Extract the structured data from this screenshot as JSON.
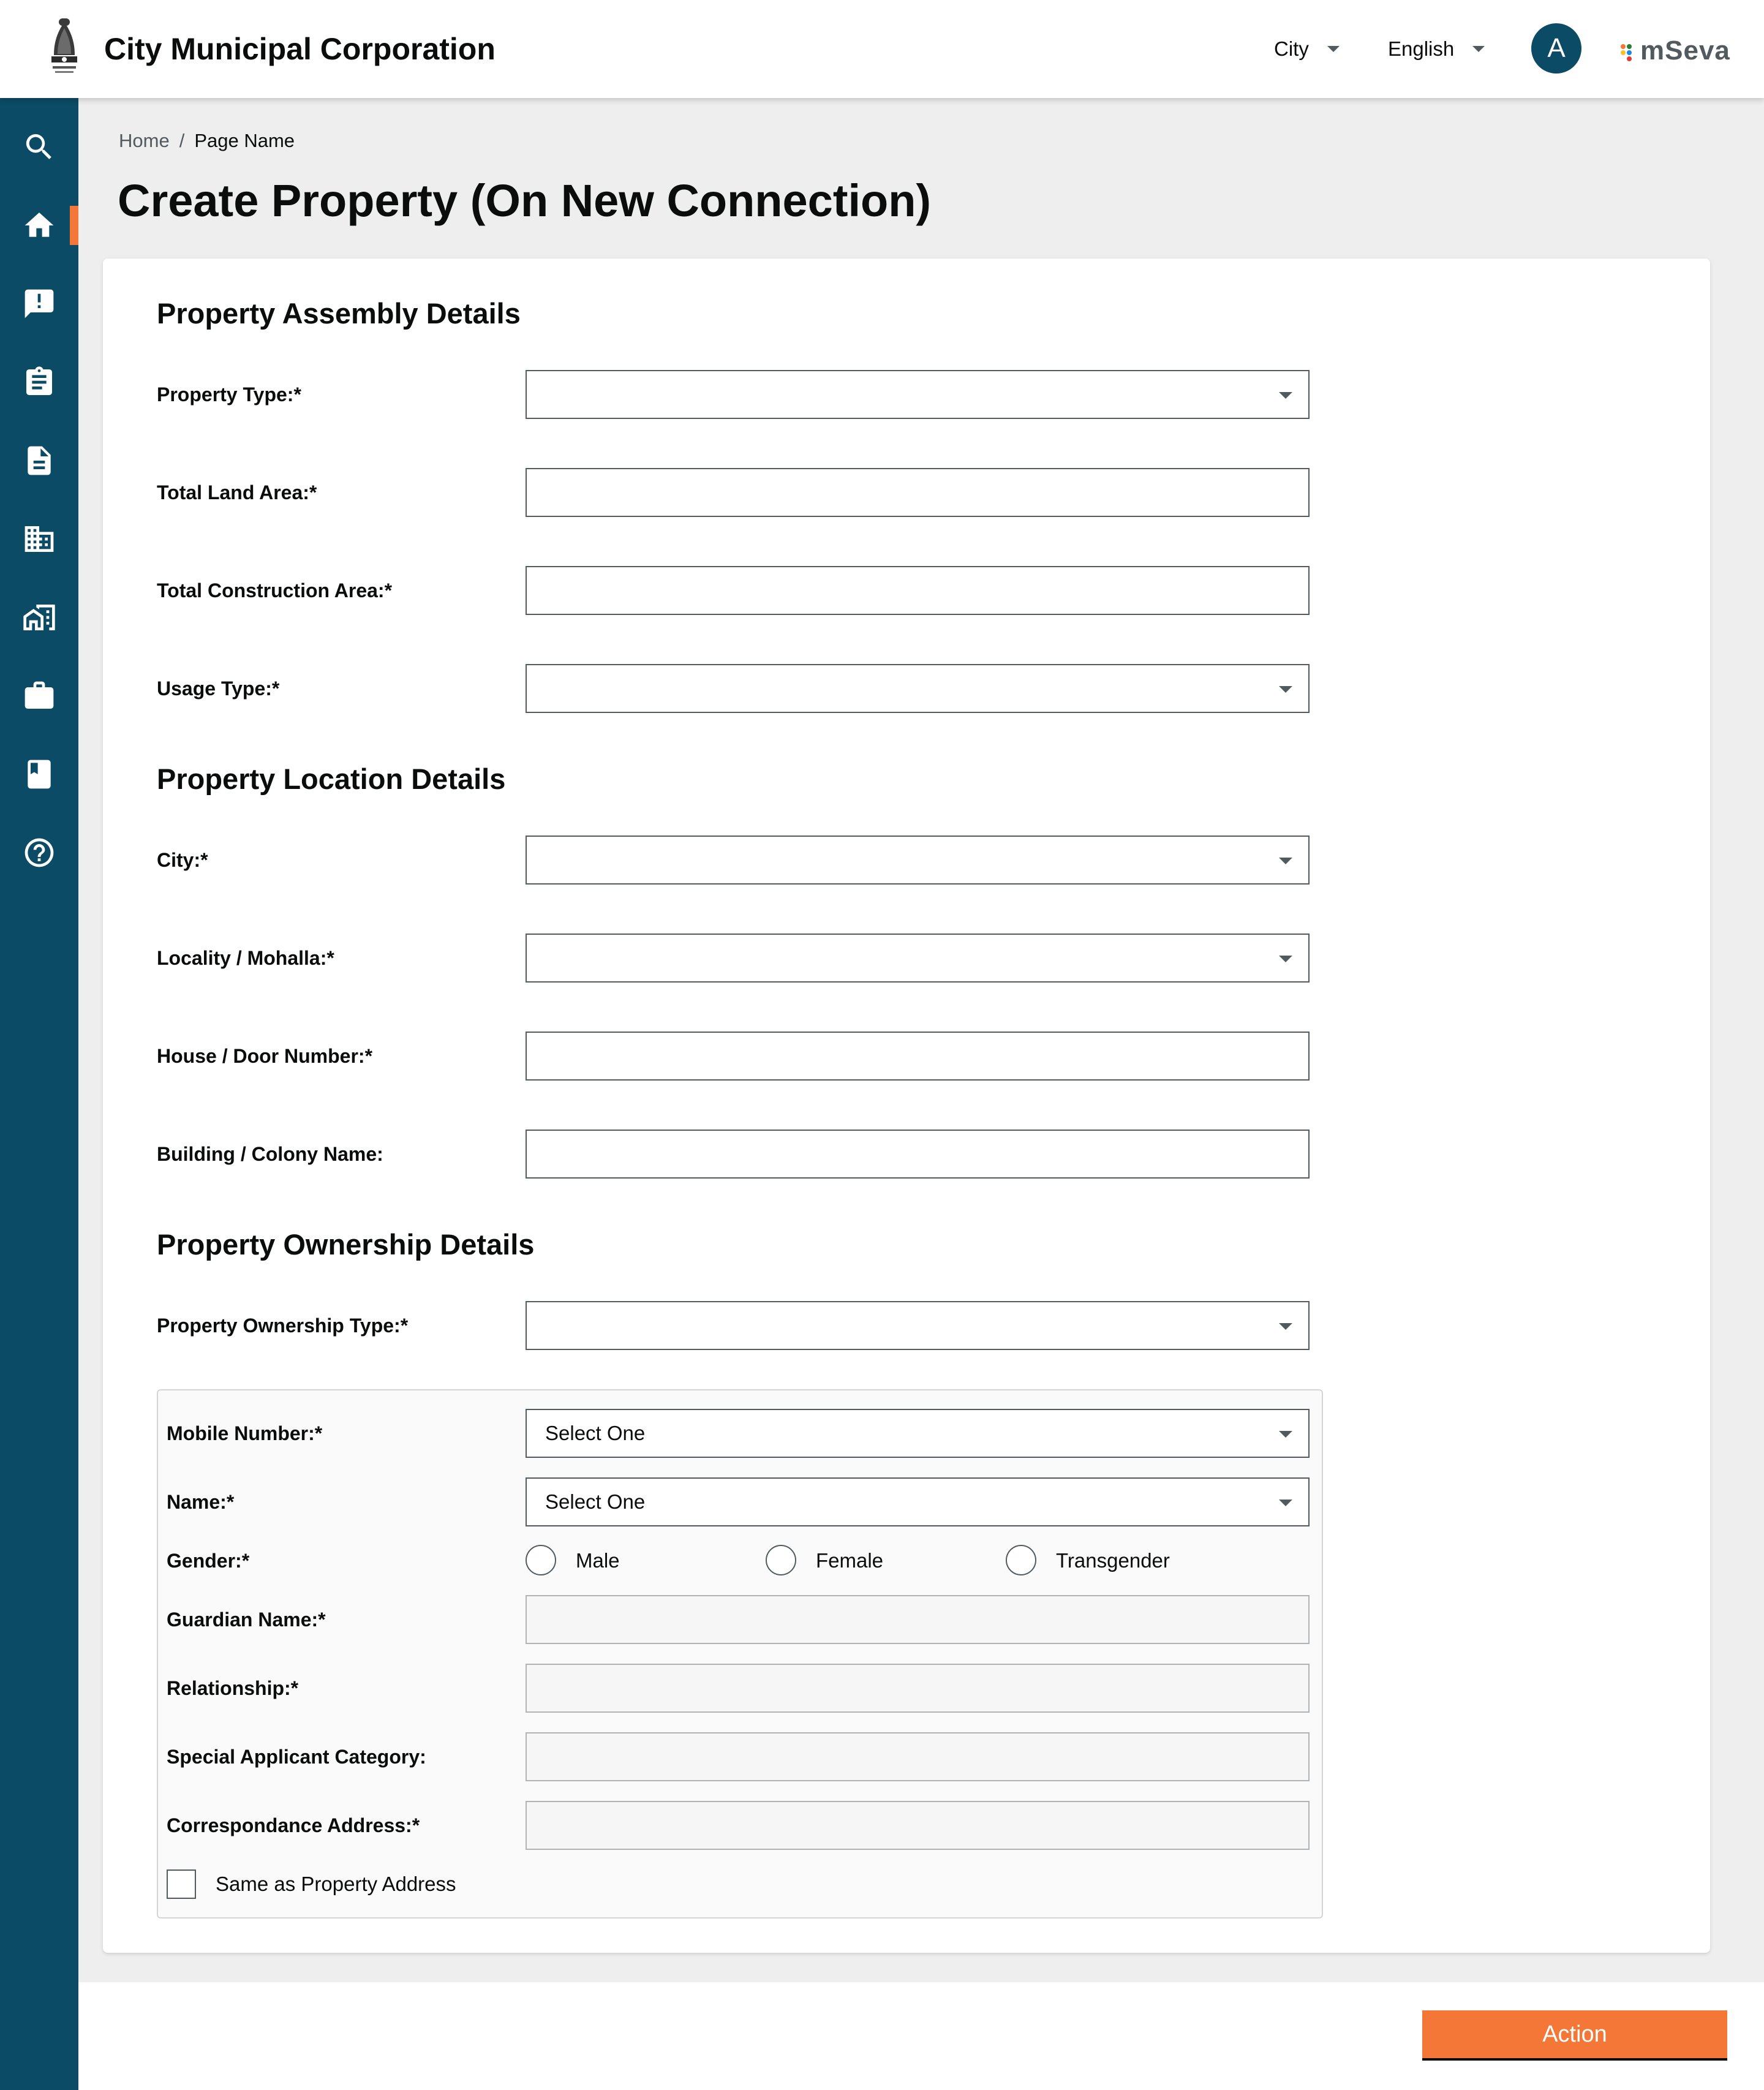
{
  "header": {
    "title": "City Municipal Corporation",
    "city_label": "City",
    "language_label": "English",
    "avatar_initial": "A",
    "brand_name": "mSeva"
  },
  "sidebar": {
    "items": [
      {
        "icon": "search-icon"
      },
      {
        "icon": "home-icon",
        "active": true
      },
      {
        "icon": "complaint-icon"
      },
      {
        "icon": "clipboard-icon"
      },
      {
        "icon": "document-icon"
      },
      {
        "icon": "building-icon"
      },
      {
        "icon": "property-icon"
      },
      {
        "icon": "briefcase-icon"
      },
      {
        "icon": "book-icon"
      },
      {
        "icon": "help-icon"
      }
    ],
    "accent_color": "#f47738",
    "background_color": "#0b4b66"
  },
  "breadcrumb": {
    "home": "Home",
    "separator": "/",
    "current": "Page Name"
  },
  "page": {
    "title": "Create Property (On New Connection)"
  },
  "assembly": {
    "title": "Property Assembly Details",
    "property_type_label": "Property Type:*",
    "land_area_label": "Total Land Area:*",
    "construction_area_label": "Total Construction Area:*",
    "usage_type_label": "Usage Type:*"
  },
  "location": {
    "title": "Property Location Details",
    "city_label": "City:*",
    "locality_label": "Locality / Mohalla:*",
    "house_label": "House / Door Number:*",
    "building_label": "Building / Colony Name:"
  },
  "ownership": {
    "title": "Property Ownership Details",
    "ownership_type_label": "Property Ownership Type:*",
    "owner": {
      "mobile_label": "Mobile Number:*",
      "mobile_value": "Select One",
      "name_label": "Name:*",
      "name_value": "Select One",
      "gender_label": "Gender:*",
      "gender_options": [
        "Male",
        "Female",
        "Transgender"
      ],
      "guardian_label": "Guardian Name:*",
      "relationship_label": "Relationship:*",
      "special_category_label": "Special Applicant Category:",
      "address_label": "Correspondance Address:*",
      "same_address_label": "Same as Property Address"
    }
  },
  "footer": {
    "action_label": "Action",
    "action_color": "#f47738"
  }
}
